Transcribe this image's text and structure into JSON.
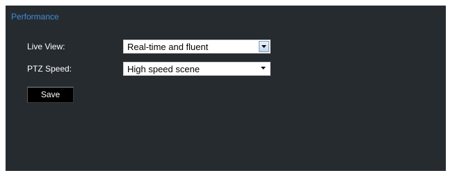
{
  "section": {
    "title": "Performance"
  },
  "fields": {
    "live_view": {
      "label": "Live View:",
      "value": "Real-time and fluent"
    },
    "ptz_speed": {
      "label": "PTZ Speed:",
      "value": "High speed scene"
    }
  },
  "actions": {
    "save_label": "Save"
  },
  "icons": {
    "dropdown": "chevron-down-icon"
  },
  "colors": {
    "panel_background": "#262b30",
    "title_accent": "#3f8fd8",
    "label_text": "#ffffff",
    "button_background": "#000000"
  }
}
